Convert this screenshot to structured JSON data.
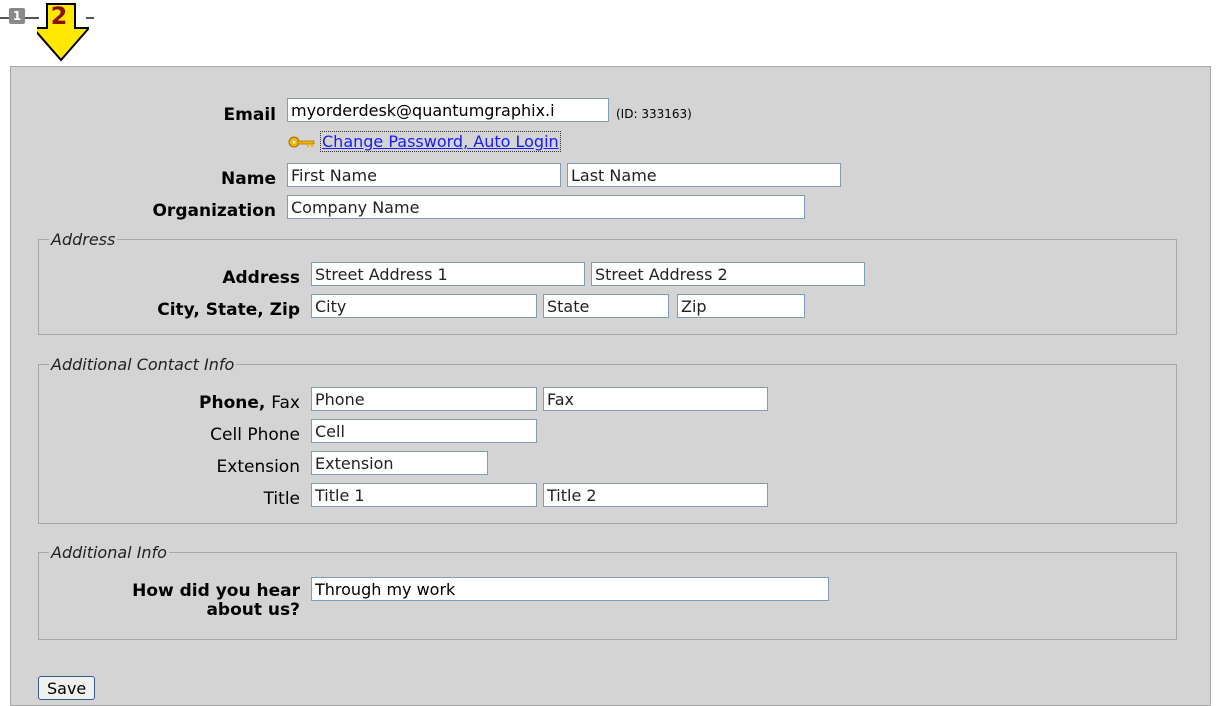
{
  "steps": {
    "step1": "1",
    "step2": "2"
  },
  "account": {
    "email_label": "Email",
    "email_value": "myorderdesk@quantumgraphix.i",
    "id_note": "(ID: 333163)",
    "change_password_link": "Change Password, Auto Login",
    "name_label": "Name",
    "first_name_placeholder": "First Name",
    "last_name_placeholder": "Last Name",
    "organization_label": "Organization",
    "organization_placeholder": "Company Name"
  },
  "address": {
    "legend": "Address",
    "address_label": "Address",
    "street1_placeholder": "Street Address 1",
    "street2_placeholder": "Street Address 2",
    "city_state_zip_label": "City, State, Zip",
    "city_placeholder": "City",
    "state_placeholder": "State",
    "zip_placeholder": "Zip"
  },
  "contact": {
    "legend": "Additional Contact Info",
    "phone_label": "Phone,",
    "fax_label": "Fax",
    "phone_placeholder": "Phone",
    "fax_placeholder": "Fax",
    "cell_label": "Cell Phone",
    "cell_placeholder": "Cell",
    "extension_label": "Extension",
    "extension_placeholder": "Extension",
    "title_label": "Title",
    "title1_placeholder": "Title 1",
    "title2_placeholder": "Title 2"
  },
  "additional": {
    "legend": "Additional Info",
    "hear_label_line1": "How did you hear",
    "hear_label_line2": "about us?",
    "hear_value": "Through my work"
  },
  "save_label": "Save"
}
